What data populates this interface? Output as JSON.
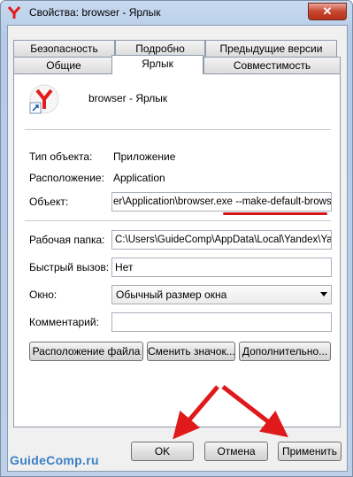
{
  "window": {
    "title": "Свойства: browser - Ярлык",
    "close": "✕"
  },
  "tabs_row1": [
    "Безопасность",
    "Подробно",
    "Предыдущие версии"
  ],
  "tabs_row2": [
    "Общие",
    "Ярлык",
    "Совместимость"
  ],
  "header": {
    "name": "browser - Ярлык"
  },
  "props": {
    "type_label": "Тип объекта:",
    "type_value": "Приложение",
    "location_label": "Расположение:",
    "location_value": "Application",
    "object_label": "Объект:",
    "object_value": "er\\Application\\browser.exe --make-default-browser",
    "workdir_label": "Рабочая папка:",
    "workdir_value": "C:\\Users\\GuideComp\\AppData\\Local\\Yandex\\Ya",
    "hotkey_label": "Быстрый вызов:",
    "hotkey_value": "Нет",
    "window_label": "Окно:",
    "window_value": "Обычный размер окна",
    "comment_label": "Комментарий:",
    "comment_value": ""
  },
  "buttons": {
    "file_location": "Расположение файла",
    "change_icon": "Сменить значок...",
    "advanced": "Дополнительно...",
    "ok": "OK",
    "cancel": "Отмена",
    "apply": "Применить"
  },
  "watermark": "GuideComp.ru",
  "colors": {
    "accent_red": "#d7141a",
    "watermark_blue": "#3b7fc4"
  }
}
